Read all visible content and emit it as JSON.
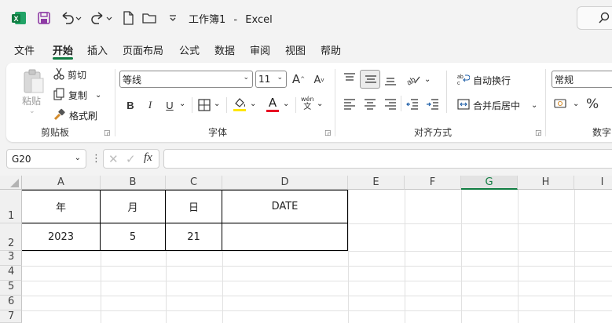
{
  "titlebar": {
    "app_icon": "excel-icon",
    "doc_name": "工作簿1",
    "separator": "-",
    "app_name": "Excel"
  },
  "menu": [
    "文件",
    "开始",
    "插入",
    "页面布局",
    "公式",
    "数据",
    "审阅",
    "视图",
    "帮助"
  ],
  "ribbon": {
    "clipboard": {
      "paste": "粘贴",
      "cut": "剪切",
      "copy": "复制",
      "format_painter": "格式刷",
      "label": "剪贴板"
    },
    "font": {
      "font_name": "等线",
      "font_size": "11",
      "bold": "B",
      "italic": "I",
      "underline": "U",
      "phonetic_top": "wén",
      "phonetic_bottom": "文",
      "font_color_glyph": "A",
      "label": "字体"
    },
    "alignment": {
      "wrap_text": "自动换行",
      "merge_center": "合并后居中",
      "label": "对齐方式"
    },
    "number": {
      "format": "常规",
      "percent": "%",
      "label": "数字"
    }
  },
  "formula_bar": {
    "name_box": "G20",
    "fx": "fx",
    "value": ""
  },
  "grid": {
    "columns": [
      "A",
      "B",
      "C",
      "D",
      "E",
      "F",
      "G",
      "H",
      "I"
    ],
    "selected_column": "G",
    "rows": [
      "1",
      "2",
      "3",
      "4",
      "5",
      "6",
      "7"
    ],
    "cells": {
      "A1": "年",
      "B1": "月",
      "C1": "日",
      "D1": "DATE",
      "A2": "2023",
      "B2": "5",
      "C2": "21",
      "D2": ""
    }
  },
  "colors": {
    "accent": "#107c41",
    "font_color_bar": "#e81123",
    "highlight_bar": "#ffe600"
  }
}
